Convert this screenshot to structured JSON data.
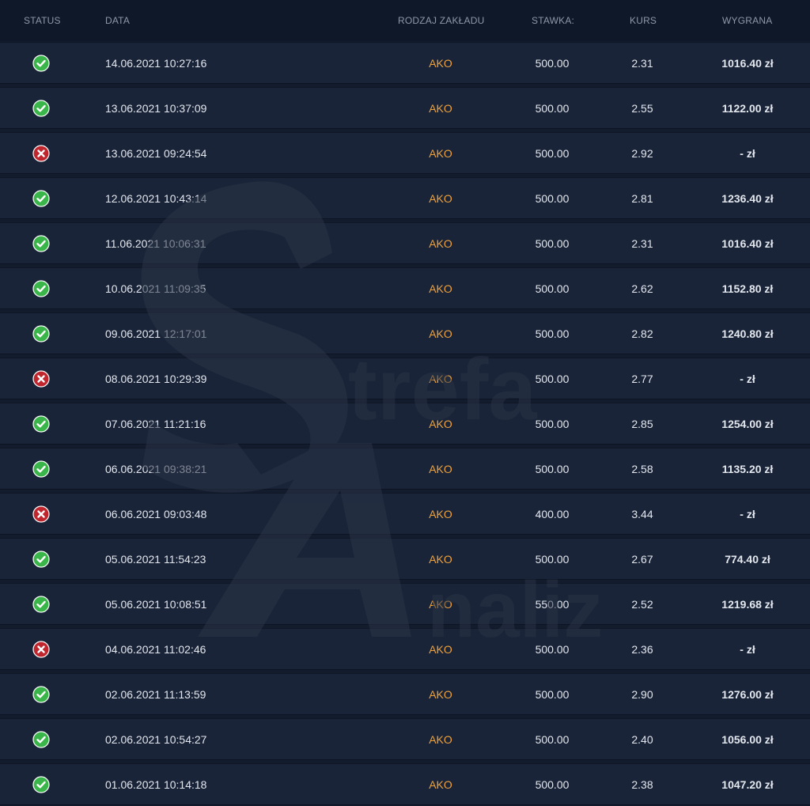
{
  "header": {
    "status": "STATUS",
    "date": "DATA",
    "type": "RODZAJ ZAKŁADU",
    "stake": "STAWKA:",
    "odds": "KURS",
    "win": "WYGRANA"
  },
  "colors": {
    "win_icon": "#3ab54a",
    "loss_icon": "#c0262d",
    "bet_type": "#f0a23a",
    "row_bg": "#1a2438"
  },
  "watermark": {
    "strefa": "trefa",
    "analiz": "naliz"
  },
  "rows": [
    {
      "status": "won",
      "icon": "check-circle-icon",
      "date": "14.06.2021 10:27:16",
      "type": "AKO",
      "stake": "500.00",
      "odds": "2.31",
      "win": "1016.40 zł"
    },
    {
      "status": "won",
      "icon": "check-circle-icon",
      "date": "13.06.2021 10:37:09",
      "type": "AKO",
      "stake": "500.00",
      "odds": "2.55",
      "win": "1122.00 zł"
    },
    {
      "status": "lost",
      "icon": "cross-circle-icon",
      "date": "13.06.2021 09:24:54",
      "type": "AKO",
      "stake": "500.00",
      "odds": "2.92",
      "win": "- zł"
    },
    {
      "status": "won",
      "icon": "check-circle-icon",
      "date": "12.06.2021 10:43:14",
      "type": "AKO",
      "stake": "500.00",
      "odds": "2.81",
      "win": "1236.40 zł"
    },
    {
      "status": "won",
      "icon": "check-circle-icon",
      "date": "11.06.2021 10:06:31",
      "type": "AKO",
      "stake": "500.00",
      "odds": "2.31",
      "win": "1016.40 zł"
    },
    {
      "status": "won",
      "icon": "check-circle-icon",
      "date": "10.06.2021 11:09:35",
      "type": "AKO",
      "stake": "500.00",
      "odds": "2.62",
      "win": "1152.80 zł"
    },
    {
      "status": "won",
      "icon": "check-circle-icon",
      "date": "09.06.2021 12:17:01",
      "type": "AKO",
      "stake": "500.00",
      "odds": "2.82",
      "win": "1240.80 zł"
    },
    {
      "status": "lost",
      "icon": "cross-circle-icon",
      "date": "08.06.2021 10:29:39",
      "type": "AKO",
      "stake": "500.00",
      "odds": "2.77",
      "win": "- zł"
    },
    {
      "status": "won",
      "icon": "check-circle-icon",
      "date": "07.06.2021 11:21:16",
      "type": "AKO",
      "stake": "500.00",
      "odds": "2.85",
      "win": "1254.00 zł"
    },
    {
      "status": "won",
      "icon": "check-circle-icon",
      "date": "06.06.2021 09:38:21",
      "type": "AKO",
      "stake": "500.00",
      "odds": "2.58",
      "win": "1135.20 zł"
    },
    {
      "status": "lost",
      "icon": "cross-circle-icon",
      "date": "06.06.2021 09:03:48",
      "type": "AKO",
      "stake": "400.00",
      "odds": "3.44",
      "win": "- zł"
    },
    {
      "status": "won",
      "icon": "check-circle-icon",
      "date": "05.06.2021 11:54:23",
      "type": "AKO",
      "stake": "500.00",
      "odds": "2.67",
      "win": "774.40 zł"
    },
    {
      "status": "won",
      "icon": "check-circle-icon",
      "date": "05.06.2021 10:08:51",
      "type": "AKO",
      "stake": "550.00",
      "odds": "2.52",
      "win": "1219.68 zł"
    },
    {
      "status": "lost",
      "icon": "cross-circle-icon",
      "date": "04.06.2021 11:02:46",
      "type": "AKO",
      "stake": "500.00",
      "odds": "2.36",
      "win": "- zł"
    },
    {
      "status": "won",
      "icon": "check-circle-icon",
      "date": "02.06.2021 11:13:59",
      "type": "AKO",
      "stake": "500.00",
      "odds": "2.90",
      "win": "1276.00 zł"
    },
    {
      "status": "won",
      "icon": "check-circle-icon",
      "date": "02.06.2021 10:54:27",
      "type": "AKO",
      "stake": "500.00",
      "odds": "2.40",
      "win": "1056.00 zł"
    },
    {
      "status": "won",
      "icon": "check-circle-icon",
      "date": "01.06.2021 10:14:18",
      "type": "AKO",
      "stake": "500.00",
      "odds": "2.38",
      "win": "1047.20 zł"
    }
  ]
}
